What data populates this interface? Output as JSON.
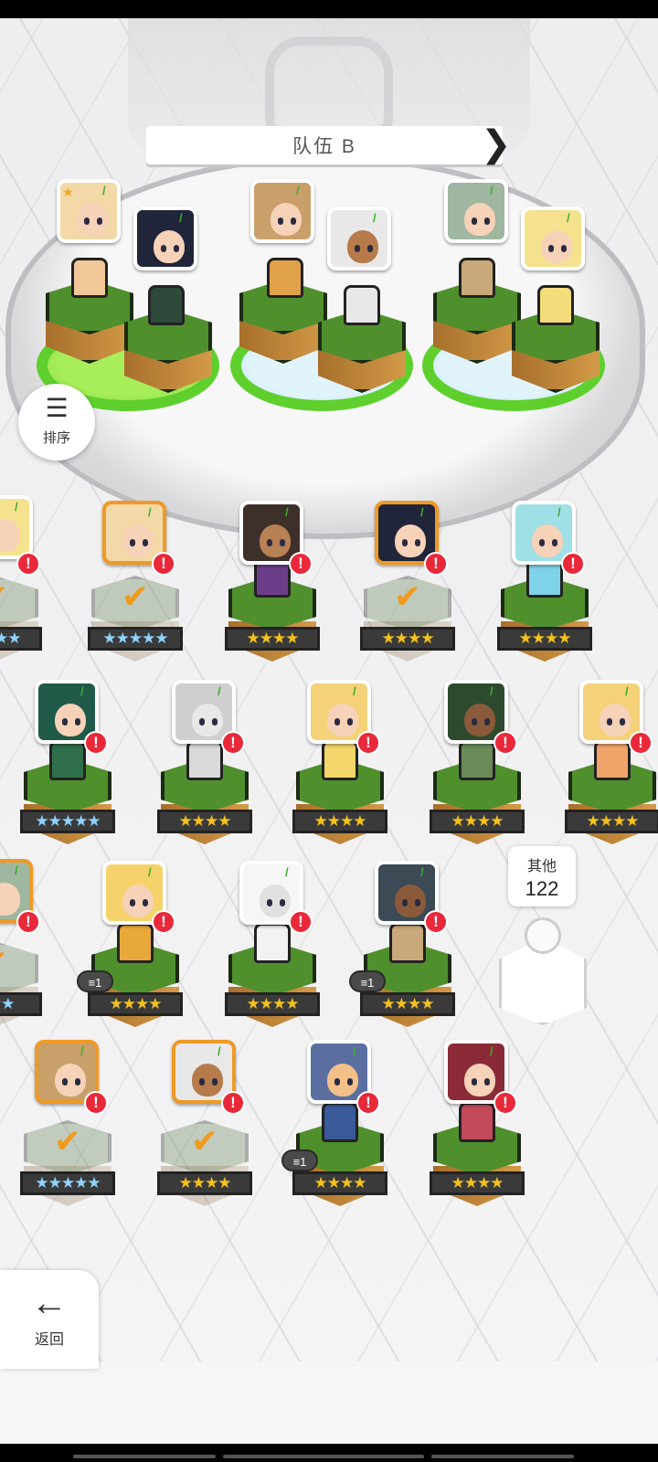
{
  "team": {
    "title": "队伍 B"
  },
  "controls": {
    "sort_label": "排序",
    "back_label": "返回"
  },
  "other": {
    "label": "其他",
    "count": "122"
  },
  "colors": {
    "accent_green": "#5fcf2e",
    "alert_red": "#e9283a",
    "selected_orange": "#ee9a26",
    "star_gold": "#f5c21b"
  },
  "roster": [
    {
      "stars": "★★★★",
      "selected": true,
      "alert": true
    },
    {
      "stars": "★★★★★",
      "selected": true,
      "alert": true
    },
    {
      "stars": "★★★★",
      "selected": false,
      "alert": true
    },
    {
      "stars": "★★★★",
      "selected": true,
      "alert": true
    },
    {
      "stars": "★★★★",
      "selected": false,
      "alert": true
    },
    {
      "stars": "★★★★★",
      "selected": false,
      "alert": true
    },
    {
      "stars": "★★★★",
      "selected": false,
      "alert": true
    },
    {
      "stars": "★★★★",
      "selected": false,
      "alert": true
    },
    {
      "stars": "★★★★",
      "selected": false,
      "alert": true
    },
    {
      "stars": "★★★★",
      "selected": false,
      "alert": true
    },
    {
      "stars": "★★★",
      "selected": true,
      "alert": true
    },
    {
      "stars": "★★★★",
      "selected": false,
      "alert": true,
      "copies": "1"
    },
    {
      "stars": "★★★★",
      "selected": false,
      "alert": true
    },
    {
      "stars": "★★★★",
      "selected": false,
      "alert": true,
      "copies": "1"
    },
    {
      "stars": "★★★★★",
      "selected": true,
      "alert": true
    },
    {
      "stars": "★★★★",
      "selected": true,
      "alert": true
    },
    {
      "stars": "★★★★",
      "selected": false,
      "alert": true,
      "copies": "1"
    },
    {
      "stars": "★★★★",
      "selected": false,
      "alert": true
    }
  ]
}
